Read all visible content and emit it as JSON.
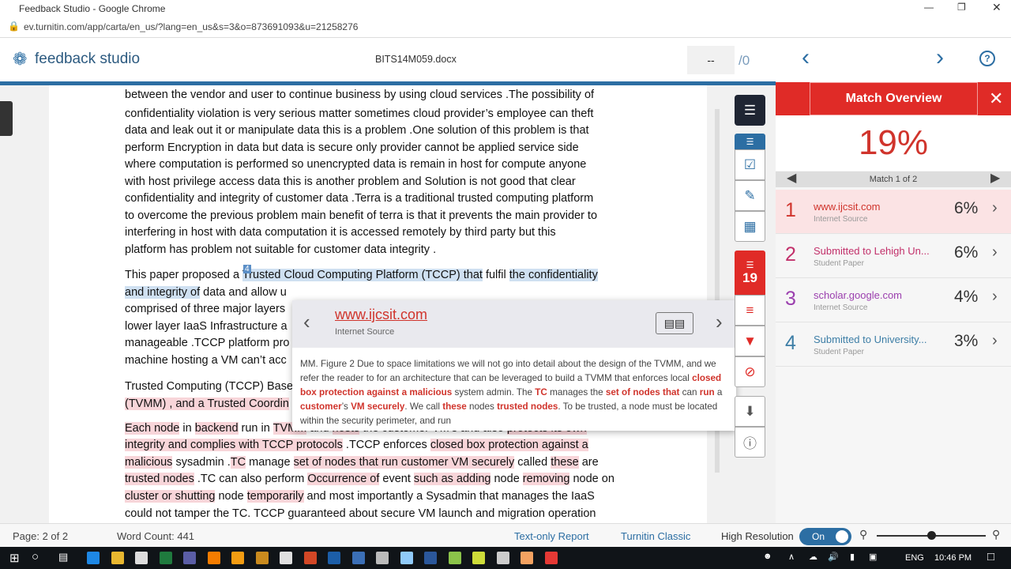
{
  "window": {
    "title": "Feedback Studio - Google Chrome",
    "url": "ev.turnitin.com/app/carta/en_us/?lang=en_us&s=3&o=873691093&u=21258276"
  },
  "header": {
    "logo": "feedback studio",
    "filename": "BITS14M059.docx",
    "page_input": "--",
    "page_total": "/0"
  },
  "doc": {
    "badge": "4",
    "lines": [
      [
        [
          "between the vendor and user to continue business by using cloud services .The possibility of",
          ""
        ]
      ],
      [
        [
          "confidentiality violation is very serious matter sometimes cloud provider’s employee can theft",
          ""
        ]
      ],
      [
        [
          "data and leak out it or manipulate data this is a problem .One solution of this problem is that",
          ""
        ]
      ],
      [
        [
          "perform Encryption in data but data is secure only provider cannot be applied service side",
          ""
        ]
      ],
      [
        [
          "where computation is performed so unencrypted data is remain in host for compute anyone",
          ""
        ]
      ],
      [
        [
          "with host privilege access data this is another problem and Solution is not good that clear",
          ""
        ]
      ],
      [
        [
          "confidentiality and integrity of customer data .Terra is a traditional trusted computing platform",
          ""
        ]
      ],
      [
        [
          "to overcome the previous problem main benefit of terra is that it prevents the main provider to",
          ""
        ]
      ],
      [
        [
          "interfering in host with data computation it is accessed remotely by third party but this",
          ""
        ]
      ],
      [
        [
          "platform has problem not suitable for customer data integrity .",
          ""
        ]
      ],
      [
        [
          "This paper proposed a ",
          ""
        ],
        [
          "Trusted Cloud Computing Platform (TCCP) that",
          "b"
        ],
        [
          " fulfil ",
          ""
        ],
        [
          "the confidentiality",
          "b"
        ]
      ],
      [
        [
          "and integrity of",
          "b"
        ],
        [
          " data and allow u",
          ""
        ]
      ],
      [
        [
          "comprised of three major layers",
          ""
        ]
      ],
      [
        [
          "lower layer IaaS Infrastructure a",
          ""
        ]
      ],
      [
        [
          "manageable .TCCP platform pro",
          ""
        ]
      ],
      [
        [
          "machine hosting a VM can’t acc",
          ""
        ]
      ],
      [
        [
          "Trusted Computing (TCCP) Base",
          ""
        ]
      ],
      [
        [
          "(TVMM) , and a Trusted Coordin",
          "r"
        ]
      ],
      [
        [
          "Each node",
          "r"
        ],
        [
          " in ",
          ""
        ],
        [
          "backend",
          "r"
        ],
        [
          " run in ",
          ""
        ],
        [
          "TVMM",
          "r"
        ],
        [
          " and ",
          ""
        ],
        [
          "hosts",
          "r"
        ],
        [
          " the customer VM’s and also ",
          ""
        ],
        [
          "protects its own",
          "r"
        ]
      ],
      [
        [
          "integrity and complies with TCCP protocols",
          "r"
        ],
        [
          " .TCCP enforces ",
          ""
        ],
        [
          "closed box protection against a",
          "r"
        ]
      ],
      [
        [
          "malicious",
          "r"
        ],
        [
          " sysadmin .",
          ""
        ],
        [
          "TC",
          "r"
        ],
        [
          " manage ",
          ""
        ],
        [
          "set of nodes that run customer VM securely",
          "r"
        ],
        [
          " called ",
          ""
        ],
        [
          "these",
          "r"
        ],
        [
          " are",
          ""
        ]
      ],
      [
        [
          "trusted nodes",
          "r"
        ],
        [
          " .TC can also perform ",
          ""
        ],
        [
          "Occurrence of",
          "r"
        ],
        [
          " event ",
          ""
        ],
        [
          "such as adding",
          "r"
        ],
        [
          " node ",
          ""
        ],
        [
          "removing",
          "r"
        ],
        [
          " node on",
          ""
        ]
      ],
      [
        [
          "cluster or shutting",
          "r"
        ],
        [
          " node ",
          ""
        ],
        [
          "temporarily",
          "r"
        ],
        [
          " and most importantly a Sysadmin that manages the IaaS",
          ""
        ]
      ],
      [
        [
          "could not tamper the TC. TCCP guaranteed about secure VM launch and migration operation",
          ""
        ]
      ]
    ]
  },
  "popup": {
    "source": "www.ijcsit.com",
    "type": "Internet Source",
    "body": [
      [
        "MM. Figure 2 Due to space limitations we will not go into detail about the design of the TVMM, and we refer the reader to for an architecture that can be leveraged to build a TVMM that enforces local ",
        ""
      ],
      [
        "closed box protection against a malicious",
        "r"
      ],
      [
        " system admin. The ",
        ""
      ],
      [
        "TC",
        "r"
      ],
      [
        " manages the ",
        ""
      ],
      [
        "set of nodes that",
        "r"
      ],
      [
        " can ",
        ""
      ],
      [
        "run",
        "r"
      ],
      [
        " a ",
        ""
      ],
      [
        "customer",
        "r"
      ],
      [
        "’s ",
        ""
      ],
      [
        "VM securely",
        "r"
      ],
      [
        ". We call ",
        ""
      ],
      [
        "these",
        "r"
      ],
      [
        " nodes ",
        ""
      ],
      [
        "trusted nodes",
        "r"
      ],
      [
        ". To be trusted, a node must be located within the security perimeter, and run",
        ""
      ]
    ]
  },
  "toolbar": {
    "match_count": "19"
  },
  "panel": {
    "title": "Match Overview",
    "percent": "19%",
    "nav": "Match 1 of 2",
    "matches": [
      {
        "n": "1",
        "source": "www.ijcsit.com",
        "type": "Internet Source",
        "pct": "6%",
        "color": "#d0342c"
      },
      {
        "n": "2",
        "source": "Submitted to Lehigh Un...",
        "type": "Student Paper",
        "pct": "6%",
        "color": "#c2306a"
      },
      {
        "n": "3",
        "source": "scholar.google.com",
        "type": "Internet Source",
        "pct": "4%",
        "color": "#9b3fae"
      },
      {
        "n": "4",
        "source": "Submitted to University...",
        "type": "Student Paper",
        "pct": "3%",
        "color": "#3d7ea6"
      }
    ]
  },
  "status": {
    "page": "Page: 2 of 2",
    "words": "Word Count: 441",
    "text_only": "Text-only Report",
    "classic": "Turnitin Classic",
    "hires": "High Resolution",
    "toggle": "On",
    "zoom_level": 0.5
  },
  "taskbar": {
    "lang": "ENG",
    "time": "10:46 PM"
  },
  "colors": {
    "brand": "#2c6ea3",
    "accent_red": "#e02b27"
  }
}
